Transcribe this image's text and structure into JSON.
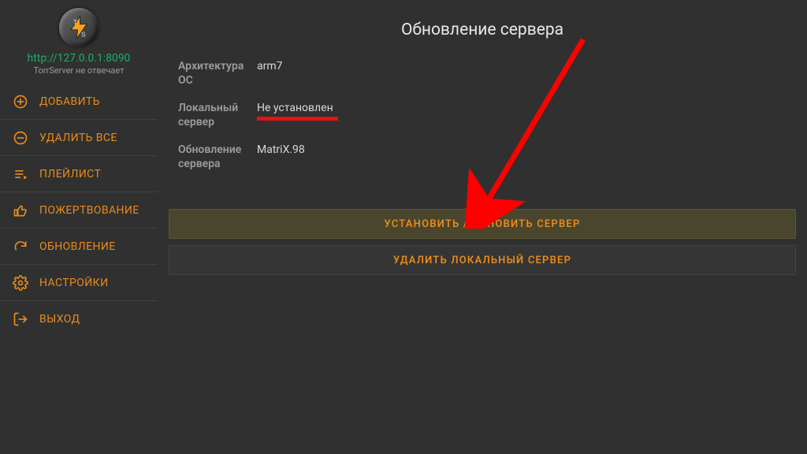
{
  "sidebar": {
    "url": "http://127.0.0.1:8090",
    "status": "TorrServer не отвечает",
    "items": [
      {
        "label": "ДОБАВИТЬ"
      },
      {
        "label": "УДАЛИТЬ ВСЕ"
      },
      {
        "label": "ПЛЕЙЛИСТ"
      },
      {
        "label": "ПОЖЕРТВОВАНИЕ"
      },
      {
        "label": "ОБНОВЛЕНИЕ"
      },
      {
        "label": "НАСТРОЙКИ"
      },
      {
        "label": "ВЫХОД"
      }
    ]
  },
  "main": {
    "title": "Обновление сервера",
    "info": {
      "arch_label": "Архитектура ОС",
      "arch_value": "arm7",
      "local_label": "Локальный сервер",
      "local_value": "Не установлен",
      "update_label": "Обновление сервера",
      "update_value": "MatriX.98"
    },
    "buttons": {
      "install": "УСТАНОВИТЬ / ОБНОВИТЬ СЕРВЕР",
      "delete": "УДАЛИТЬ ЛОКАЛЬНЫЙ СЕРВЕР"
    }
  },
  "colors": {
    "accent": "#e88b1d",
    "annotation": "#ff0000"
  }
}
